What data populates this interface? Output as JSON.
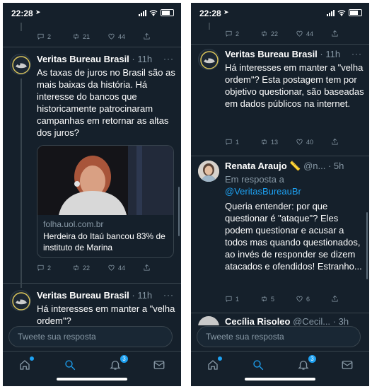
{
  "phones": {
    "left": {
      "time": "22:28",
      "feed": {
        "top_actions": {
          "reply": "2",
          "retweet": "21",
          "like": "44"
        },
        "tweet1": {
          "author": "Veritas Bureau Brasil",
          "age": "11h",
          "text": "As taxas de juros no Brasil são as mais baixas da história. Há interesse do bancos que historicamente patrocinaram campanhas em retornar as altas dos juros?",
          "card_domain": "folha.uol.com.br",
          "card_title": "Herdeira do Itaú bancou 83% de instituto de Marina",
          "actions": {
            "reply": "2",
            "retweet": "22",
            "like": "44"
          }
        },
        "tweet2": {
          "author": "Veritas Bureau Brasil",
          "age": "11h",
          "text": "Há interesses em manter a \"velha ordem\"?"
        }
      },
      "composer_placeholder": "Tweete sua resposta"
    },
    "right": {
      "time": "22:28",
      "feed": {
        "top_actions": {
          "reply": "2",
          "retweet": "22",
          "like": "44"
        },
        "tweet1": {
          "author": "Veritas Bureau Brasil",
          "age": "11h",
          "text": "Há interesses em manter a \"velha ordem\"? Esta postagem tem por objetivo questionar, são baseadas em dados públicos na internet.",
          "actions": {
            "reply": "1",
            "retweet": "13",
            "like": "40"
          }
        },
        "tweet2": {
          "author": "Renata Araujo",
          "author_emoji": "📏",
          "handle": "@n...",
          "age": "5h",
          "replying_to_label": "Em resposta a",
          "replying_to_handle": "@VeritasBureauBr",
          "text": "Queria entender: por que questionar é \"ataque\"? Eles podem questionar e acusar a todos mas quando questionados, ao invés de responder se dizem atacados e ofendidos! Estranho...",
          "actions": {
            "reply": "1",
            "retweet": "5",
            "like": "6"
          }
        },
        "tweet3": {
          "author": "Cecília Risoleo",
          "handle": "@Cecil...",
          "age": "3h"
        }
      },
      "composer_placeholder": "Tweete sua resposta",
      "notification_count": "3"
    }
  },
  "left_notification_count": "3",
  "colors": {
    "background": "#15202b",
    "accent": "#1da1f2",
    "muted": "#8899a6",
    "border": "#38444d"
  },
  "icons": [
    "reply-icon",
    "retweet-icon",
    "like-icon",
    "share-icon",
    "home-icon",
    "search-icon",
    "notifications-icon",
    "messages-icon",
    "more-icon",
    "location-arrow-icon",
    "signal-icon",
    "wifi-icon",
    "battery-icon"
  ]
}
